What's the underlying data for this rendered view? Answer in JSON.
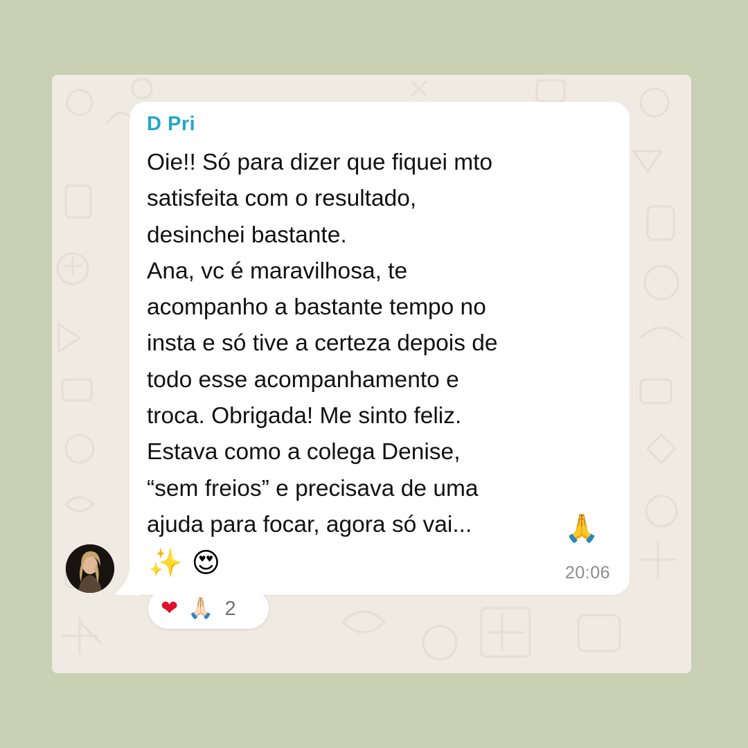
{
  "chat": {
    "sender_name": "D Pri",
    "message_text": "Oie!! Só para dizer que fiquei mto\nsatisfeita com o resultado,\ndesinchei bastante.\nAna, vc é maravilhosa, te\nacompanho a bastante tempo no\ninsta e só tive a certeza depois de\ntodo esse acompanhamento e\ntroca. Obrigada! Me sinto feliz.\nEstava como a colega Denise,\n“sem freios” e precisava de uma\najuda para focar, agora só vai...",
    "inline_emoji": "🙏",
    "trailing_emojis": "✨ 😍",
    "timestamp": "20:06",
    "avatar_icon": "user-avatar-photo",
    "reactions": {
      "emojis": [
        "❤",
        "🙏🏻"
      ],
      "count": "2"
    }
  },
  "colors": {
    "page_background": "#cad0b3",
    "chat_wallpaper": "#efeae2",
    "bubble": "#ffffff",
    "sender_name": "#24a6cc",
    "timestamp": "#8c8c8c"
  }
}
